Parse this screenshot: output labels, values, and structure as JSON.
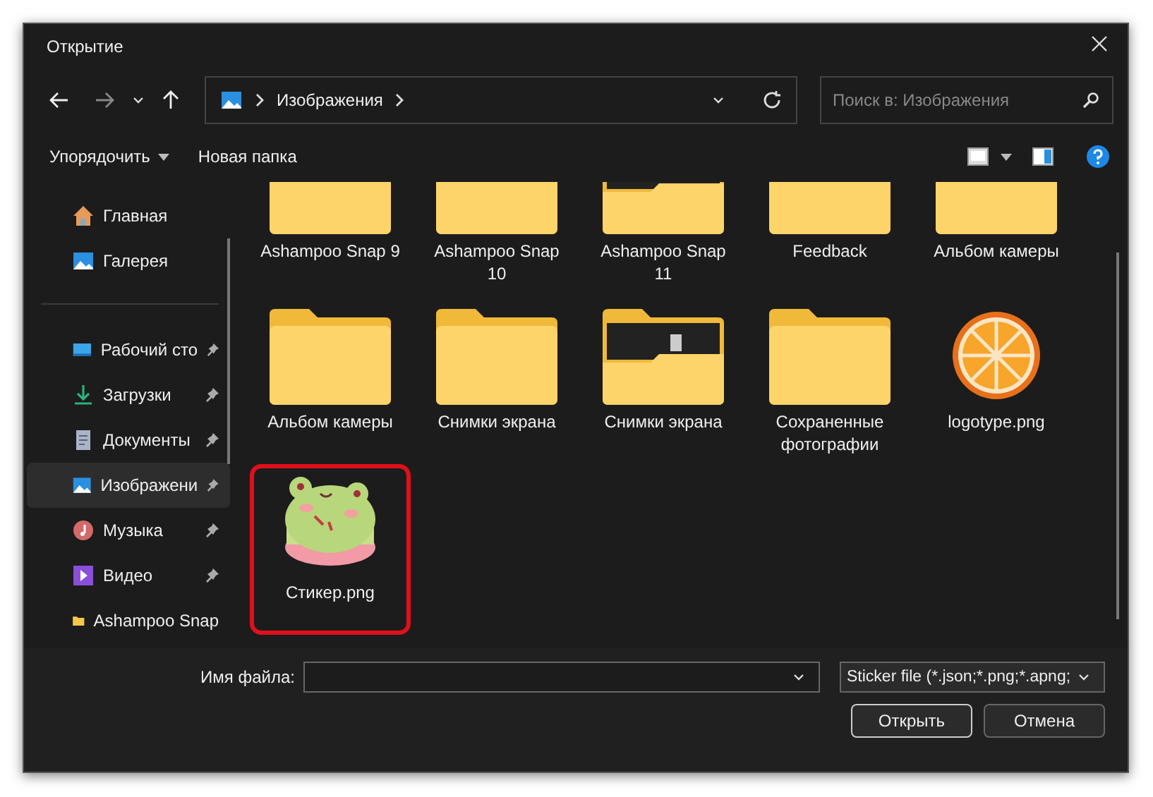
{
  "window": {
    "title": "Открытие"
  },
  "address": {
    "crumbs": [
      "Изображения"
    ]
  },
  "search": {
    "placeholder": "Поиск в: Изображения"
  },
  "toolbar": {
    "organize": "Упорядочить",
    "new_folder": "Новая папка"
  },
  "sidebar": {
    "quick": [
      {
        "label": "Главная",
        "kind": "home",
        "selected": false,
        "pinned": false
      },
      {
        "label": "Галерея",
        "kind": "gallery",
        "selected": false,
        "pinned": false
      }
    ],
    "items": [
      {
        "label": "Рабочий сто",
        "kind": "desktop",
        "selected": false,
        "pinned": true
      },
      {
        "label": "Загрузки",
        "kind": "downloads",
        "selected": false,
        "pinned": true
      },
      {
        "label": "Документы",
        "kind": "documents",
        "selected": false,
        "pinned": true
      },
      {
        "label": "Изображени",
        "kind": "pictures",
        "selected": true,
        "pinned": true
      },
      {
        "label": "Музыка",
        "kind": "music",
        "selected": false,
        "pinned": true
      },
      {
        "label": "Видео",
        "kind": "video",
        "selected": false,
        "pinned": true
      },
      {
        "label": "Ashampoo Snap",
        "kind": "folder",
        "selected": false,
        "pinned": false
      }
    ]
  },
  "files": [
    {
      "name": "Ashampoo Snap 9",
      "kind": "folder",
      "highlighted": false
    },
    {
      "name": "Ashampoo Snap 10",
      "kind": "folder",
      "highlighted": false
    },
    {
      "name": "Ashampoo Snap 11",
      "kind": "folder-preview",
      "highlighted": false
    },
    {
      "name": "Feedback",
      "kind": "folder",
      "highlighted": false
    },
    {
      "name": "Альбом камеры",
      "kind": "folder",
      "highlighted": false
    },
    {
      "name": "Альбом камеры",
      "kind": "folder",
      "highlighted": false
    },
    {
      "name": "Снимки экрана",
      "kind": "folder",
      "highlighted": false
    },
    {
      "name": "Снимки экрана",
      "kind": "folder-preview",
      "highlighted": false
    },
    {
      "name": "Сохраненные фотографии",
      "kind": "folder",
      "highlighted": false
    },
    {
      "name": "logotype.png",
      "kind": "orange",
      "highlighted": false
    },
    {
      "name": "Стикер.png",
      "kind": "sticker",
      "highlighted": true
    }
  ],
  "footer": {
    "filename_label": "Имя файла:",
    "filter": "Sticker file (*.json;*.png;*.apng;",
    "open": "Открыть",
    "cancel": "Отмена"
  }
}
